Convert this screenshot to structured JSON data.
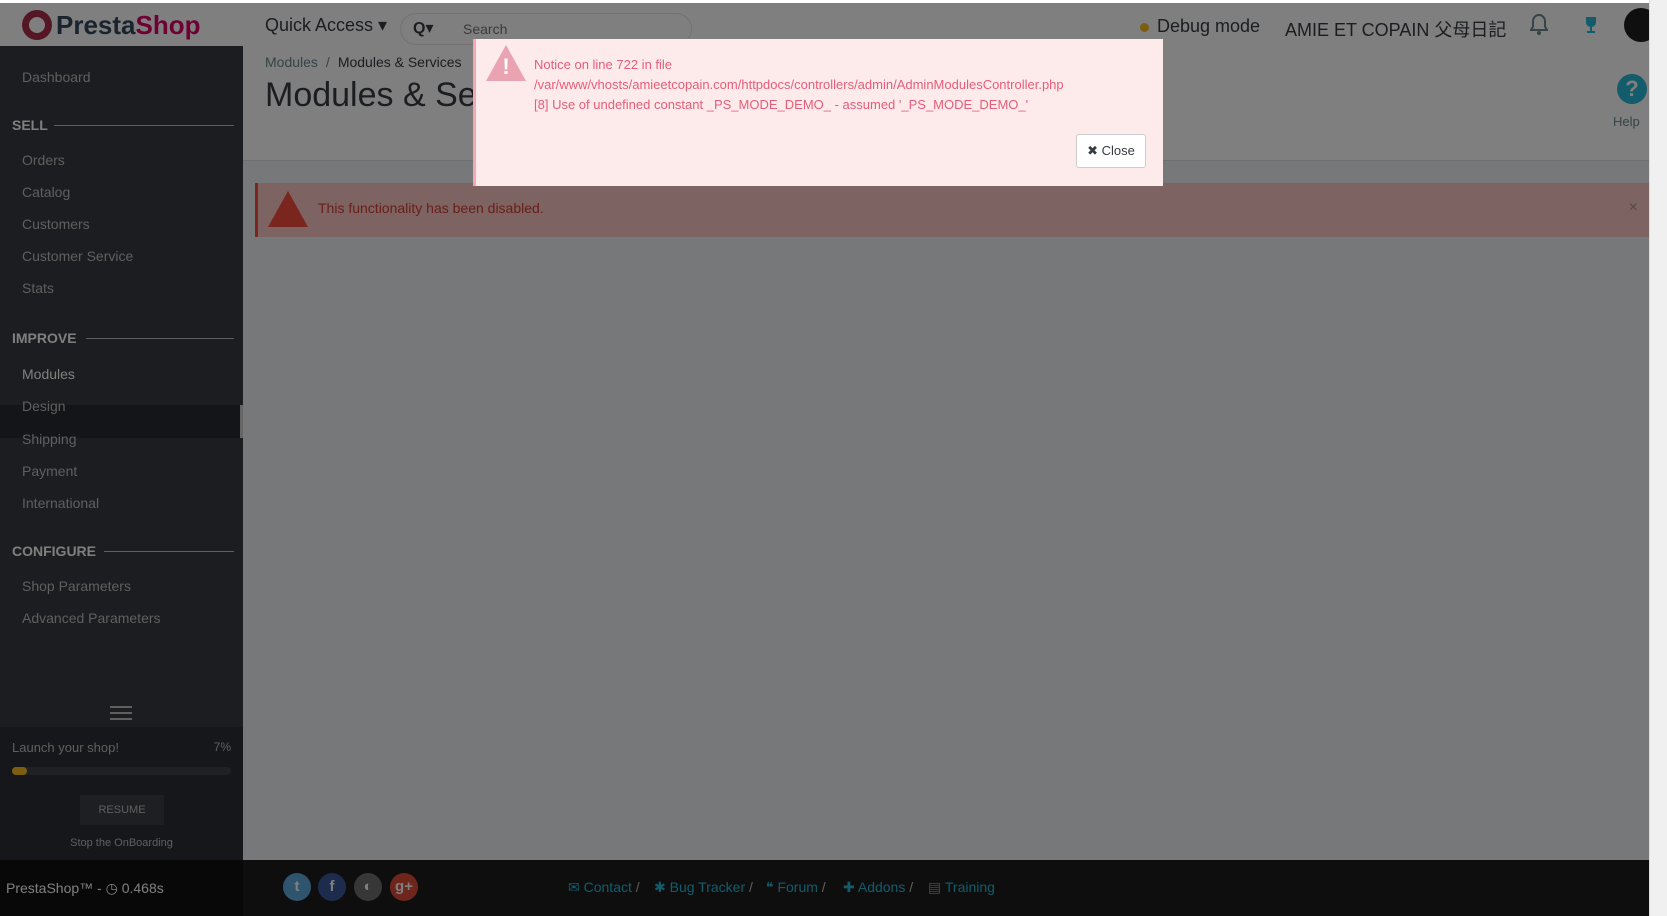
{
  "header": {
    "logo_text_left": "Presta",
    "logo_text_right": "Shop",
    "quick_access": "Quick Access ▾",
    "search_icon_label": "Q▾",
    "search_placeholder": "Search",
    "debug_mode": "Debug mode",
    "shop_name": "AMIE ET COPAIN 父母日記"
  },
  "sidebar": {
    "dashboard": "Dashboard",
    "sections": [
      {
        "title": "SELL",
        "items": [
          "Orders",
          "Catalog",
          "Customers",
          "Customer Service",
          "Stats"
        ]
      },
      {
        "title": "IMPROVE",
        "items": [
          "Modules",
          "Design",
          "Shipping",
          "Payment",
          "International"
        ]
      },
      {
        "title": "CONFIGURE",
        "items": [
          "Shop Parameters",
          "Advanced Parameters"
        ]
      }
    ],
    "active_item": "Modules",
    "onboarding": {
      "label": "Launch your shop!",
      "percent_label": "7%",
      "progress": 7,
      "resume": "RESUME",
      "stop": "Stop the OnBoarding"
    }
  },
  "main": {
    "breadcrumb": [
      "Modules",
      "Modules & Services"
    ],
    "breadcrumb_sep": "/",
    "title": "Modules & Ser",
    "help_label": "Help",
    "disabled_alert": "This functionality has been disabled.",
    "alert_close": "×"
  },
  "modal": {
    "line1": "Notice on line 722 in file",
    "line2": "/var/www/vhosts/amieetcopain.com/httpdocs/controllers/admin/AdminModulesController.php",
    "line3": "[8] Use of undefined constant _PS_MODE_DEMO_ - assumed '_PS_MODE_DEMO_'",
    "close": "✖ Close"
  },
  "footer": {
    "version": "PrestaShop™ - ◷ 0.468s",
    "links": [
      "Contact",
      "Bug Tracker",
      "Forum",
      "Addons",
      "Training"
    ],
    "sep": "/"
  },
  "colors": {
    "sidebar_bg": "#363a41",
    "accent": "#25b9d7",
    "brand_pink": "#df0067",
    "alert_red": "#f54c3e",
    "progress": "#fbbb22"
  }
}
